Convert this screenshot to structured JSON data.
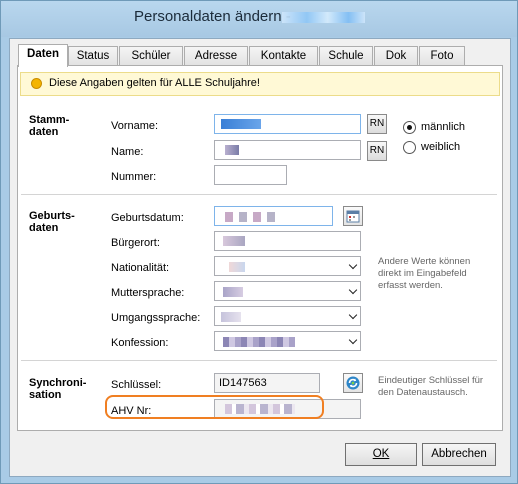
{
  "window": {
    "title": "Personaldaten ändern -"
  },
  "tabs": [
    "Daten",
    "Status",
    "Schüler",
    "Adresse",
    "Kontakte",
    "Schule",
    "Dok",
    "Foto"
  ],
  "banner": {
    "text": "Diese Angaben gelten für ALLE Schuljahre!"
  },
  "stammdaten": {
    "section_label": "Stamm-\ndaten",
    "vorname_label": "Vorname:",
    "name_label": "Name:",
    "nummer_label": "Nummer:",
    "rn_label": "RN",
    "gender_male": "männlich",
    "gender_female": "weiblich",
    "gender_selected": "männlich"
  },
  "geburtsdaten": {
    "section_label": "Geburts-\ndaten",
    "geburtsdatum_label": "Geburtsdatum:",
    "buergerort_label": "Bürgerort:",
    "nationalitaet_label": "Nationalität:",
    "muttersprache_label": "Muttersprache:",
    "umgangssprache_label": "Umgangssprache:",
    "konfession_label": "Konfession:",
    "note": "Andere Werte können\ndirekt im Eingabefeld\nerfasst werden."
  },
  "synchronisation": {
    "section_label": "Synchroni-\nsation",
    "schluessel_label": "Schlüssel:",
    "schluessel_value": "ID147563",
    "ahv_label": "AHV Nr:",
    "note": "Eindeutiger Schlüssel für\nden Datenaustausch."
  },
  "buttons": {
    "ok": "OK",
    "cancel": "Abbrechen"
  },
  "colors": {
    "highlight": "#f07f22",
    "banner_bg": "#fff9d6",
    "window_frame": "#a9cbe6"
  },
  "icons": {
    "calendar": "calendar-icon",
    "sync": "sync-icon",
    "warning": "warning-dot-icon"
  }
}
